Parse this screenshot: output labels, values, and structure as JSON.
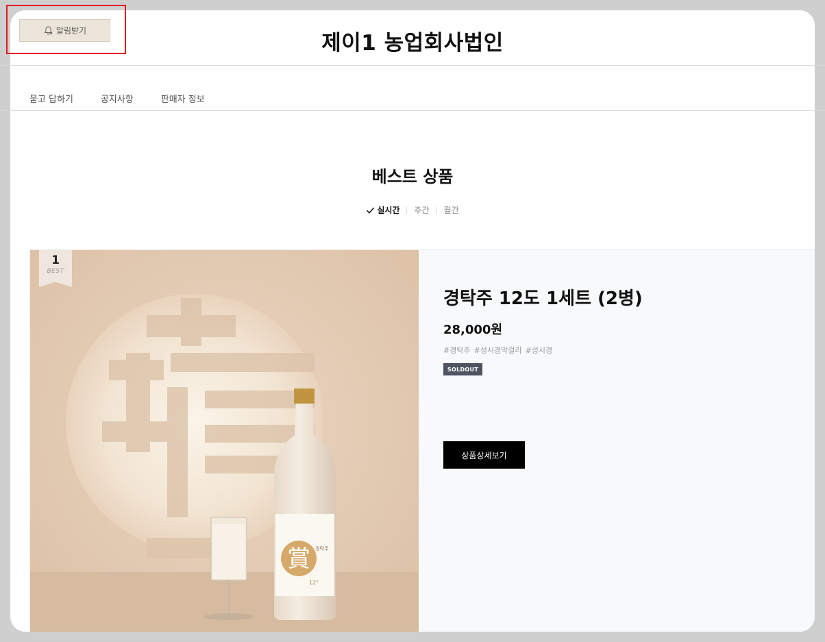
{
  "header": {
    "alarm_label": "알림받기",
    "store_title": "제이1 농업회사법인"
  },
  "nav": {
    "items": [
      {
        "label": "묻고 답하기"
      },
      {
        "label": "공지사항"
      },
      {
        "label": "판매자 정보"
      }
    ]
  },
  "best": {
    "title": "베스트 상품",
    "tabs": [
      {
        "label": "실시간",
        "active": true
      },
      {
        "label": "주간",
        "active": false
      },
      {
        "label": "월간",
        "active": false
      }
    ]
  },
  "product": {
    "rank": "1",
    "badge": "BEST",
    "name": "경탁주 12도 1세트 (2병)",
    "price": "28,000원",
    "tags": [
      "#경탁주",
      "#성시경막걸리",
      "#성시경"
    ],
    "status": "SOLDOUT",
    "detail_button": "상품상세보기",
    "label_glyph": "賞",
    "label_brand": "경탁주",
    "label_abv": "12°"
  },
  "colors": {
    "highlight": "#e01b1b",
    "alarm_bg": "#ece5da",
    "soldout_bg": "#4e5561",
    "button_bg": "#000000"
  }
}
